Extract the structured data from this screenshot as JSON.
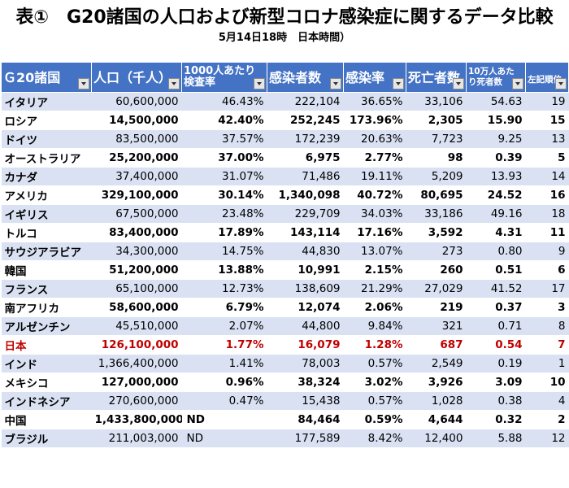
{
  "title": "表①　G20諸国の人口および新型コロナ感染症に関するデータ比較",
  "subtitle": "5月14日18時　日本時間）",
  "headers": [
    {
      "l1": "Ｇ20諸国",
      "l2": ""
    },
    {
      "l1": "人口（千人）",
      "l2": ""
    },
    {
      "l1": "1000人あたり",
      "l2": "検査率"
    },
    {
      "l1": "感染者数",
      "l2": ""
    },
    {
      "l1": "感染率",
      "l2": ""
    },
    {
      "l1": "死亡者数",
      "l2": ""
    },
    {
      "l1": "10万人あた",
      "l2": "り死者数"
    },
    {
      "l1": "左記順位",
      "l2": ""
    }
  ],
  "rows": [
    {
      "country": "イタリア",
      "population": "60,600,000",
      "test_rate": "46.43%",
      "infected": "222,104",
      "infection_rate": "36.65%",
      "deaths": "33,106",
      "deaths_per_100k": "54.63",
      "rank": "19"
    },
    {
      "country": "ロシア",
      "population": "14,500,000",
      "test_rate": "42.40%",
      "infected": "252,245",
      "infection_rate": "173.96%",
      "deaths": "2,305",
      "deaths_per_100k": "15.90",
      "rank": "15"
    },
    {
      "country": "ドイツ",
      "population": "83,500,000",
      "test_rate": "37.57%",
      "infected": "172,239",
      "infection_rate": "20.63%",
      "deaths": "7,723",
      "deaths_per_100k": "9.25",
      "rank": "13"
    },
    {
      "country": "オーストラリア",
      "population": "25,200,000",
      "test_rate": "37.00%",
      "infected": "6,975",
      "infection_rate": "2.77%",
      "deaths": "98",
      "deaths_per_100k": "0.39",
      "rank": "5"
    },
    {
      "country": "カナダ",
      "population": "37,400,000",
      "test_rate": "31.07%",
      "infected": "71,486",
      "infection_rate": "19.11%",
      "deaths": "5,209",
      "deaths_per_100k": "13.93",
      "rank": "14"
    },
    {
      "country": "アメリカ",
      "population": "329,100,000",
      "test_rate": "30.14%",
      "infected": "1,340,098",
      "infection_rate": "40.72%",
      "deaths": "80,695",
      "deaths_per_100k": "24.52",
      "rank": "16"
    },
    {
      "country": "イギリス",
      "population": "67,500,000",
      "test_rate": "23.48%",
      "infected": "229,709",
      "infection_rate": "34.03%",
      "deaths": "33,186",
      "deaths_per_100k": "49.16",
      "rank": "18"
    },
    {
      "country": "トルコ",
      "population": "83,400,000",
      "test_rate": "17.89%",
      "infected": "143,114",
      "infection_rate": "17.16%",
      "deaths": "3,592",
      "deaths_per_100k": "4.31",
      "rank": "11"
    },
    {
      "country": "サウジアラビア",
      "population": "34,300,000",
      "test_rate": "14.75%",
      "infected": "44,830",
      "infection_rate": "13.07%",
      "deaths": "273",
      "deaths_per_100k": "0.80",
      "rank": "9"
    },
    {
      "country": "韓国",
      "population": "51,200,000",
      "test_rate": "13.88%",
      "infected": "10,991",
      "infection_rate": "2.15%",
      "deaths": "260",
      "deaths_per_100k": "0.51",
      "rank": "6"
    },
    {
      "country": "フランス",
      "population": "65,100,000",
      "test_rate": "12.73%",
      "infected": "138,609",
      "infection_rate": "21.29%",
      "deaths": "27,029",
      "deaths_per_100k": "41.52",
      "rank": "17"
    },
    {
      "country": "南アフリカ",
      "population": "58,600,000",
      "test_rate": "6.79%",
      "infected": "12,074",
      "infection_rate": "2.06%",
      "deaths": "219",
      "deaths_per_100k": "0.37",
      "rank": "3"
    },
    {
      "country": "アルゼンチン",
      "population": "45,510,000",
      "test_rate": "2.07%",
      "infected": "44,800",
      "infection_rate": "9.84%",
      "deaths": "321",
      "deaths_per_100k": "0.71",
      "rank": "8"
    },
    {
      "country": "日本",
      "population": "126,100,000",
      "test_rate": "1.77%",
      "infected": "16,079",
      "infection_rate": "1.28%",
      "deaths": "687",
      "deaths_per_100k": "0.54",
      "rank": "7",
      "highlight": true
    },
    {
      "country": "インド",
      "population": "1,366,400,000",
      "test_rate": "1.41%",
      "infected": "78,003",
      "infection_rate": "0.57%",
      "deaths": "2,549",
      "deaths_per_100k": "0.19",
      "rank": "1"
    },
    {
      "country": "メキシコ",
      "population": "127,000,000",
      "test_rate": "0.96%",
      "infected": "38,324",
      "infection_rate": "3.02%",
      "deaths": "3,926",
      "deaths_per_100k": "3.09",
      "rank": "10"
    },
    {
      "country": "インドネシア",
      "population": "270,600,000",
      "test_rate": "0.47%",
      "infected": "15,438",
      "infection_rate": "0.57%",
      "deaths": "1,028",
      "deaths_per_100k": "0.38",
      "rank": "4"
    },
    {
      "country": "中国",
      "population": "1,433,800,000",
      "test_rate": "ND",
      "infected": "84,464",
      "infection_rate": "0.59%",
      "deaths": "4,644",
      "deaths_per_100k": "0.32",
      "rank": "2"
    },
    {
      "country": "ブラジル",
      "population": "211,003,000",
      "test_rate": "ND",
      "infected": "177,589",
      "infection_rate": "8.42%",
      "deaths": "12,400",
      "deaths_per_100k": "5.88",
      "rank": "12"
    }
  ],
  "colors": {
    "header_bg": "#4473c5",
    "alt_row_bg": "#d9e1f3",
    "highlight_text": "#c00000"
  }
}
